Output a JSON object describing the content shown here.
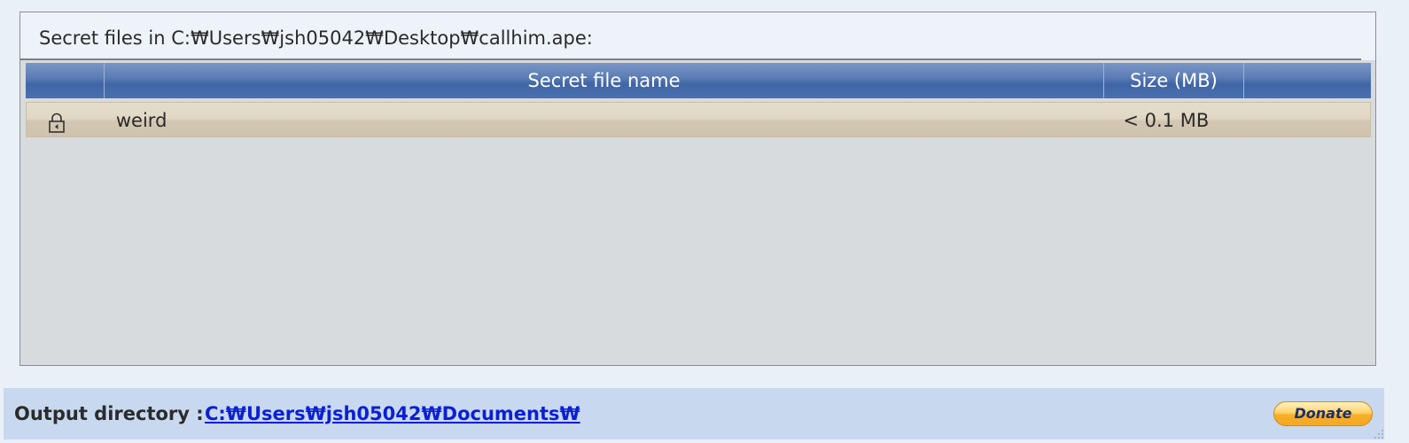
{
  "panel": {
    "title": "Secret files in C:₩Users₩jsh05042₩Desktop₩callhim.ape:"
  },
  "table": {
    "columns": [
      "",
      "Secret file name",
      "Size (MB)",
      ""
    ],
    "rows": [
      {
        "icon": "lock-icon",
        "name": "weird",
        "size": "< 0.1 MB"
      }
    ]
  },
  "footer": {
    "label": "Output directory :",
    "path": "C:₩Users₩jsh05042₩Documents₩",
    "donate_label": "Donate"
  },
  "colors": {
    "header_blue": "#4a70ae",
    "row_selected": "#dcd3bf",
    "link": "#0a1fd6",
    "donate_gold": "#f5a623"
  }
}
